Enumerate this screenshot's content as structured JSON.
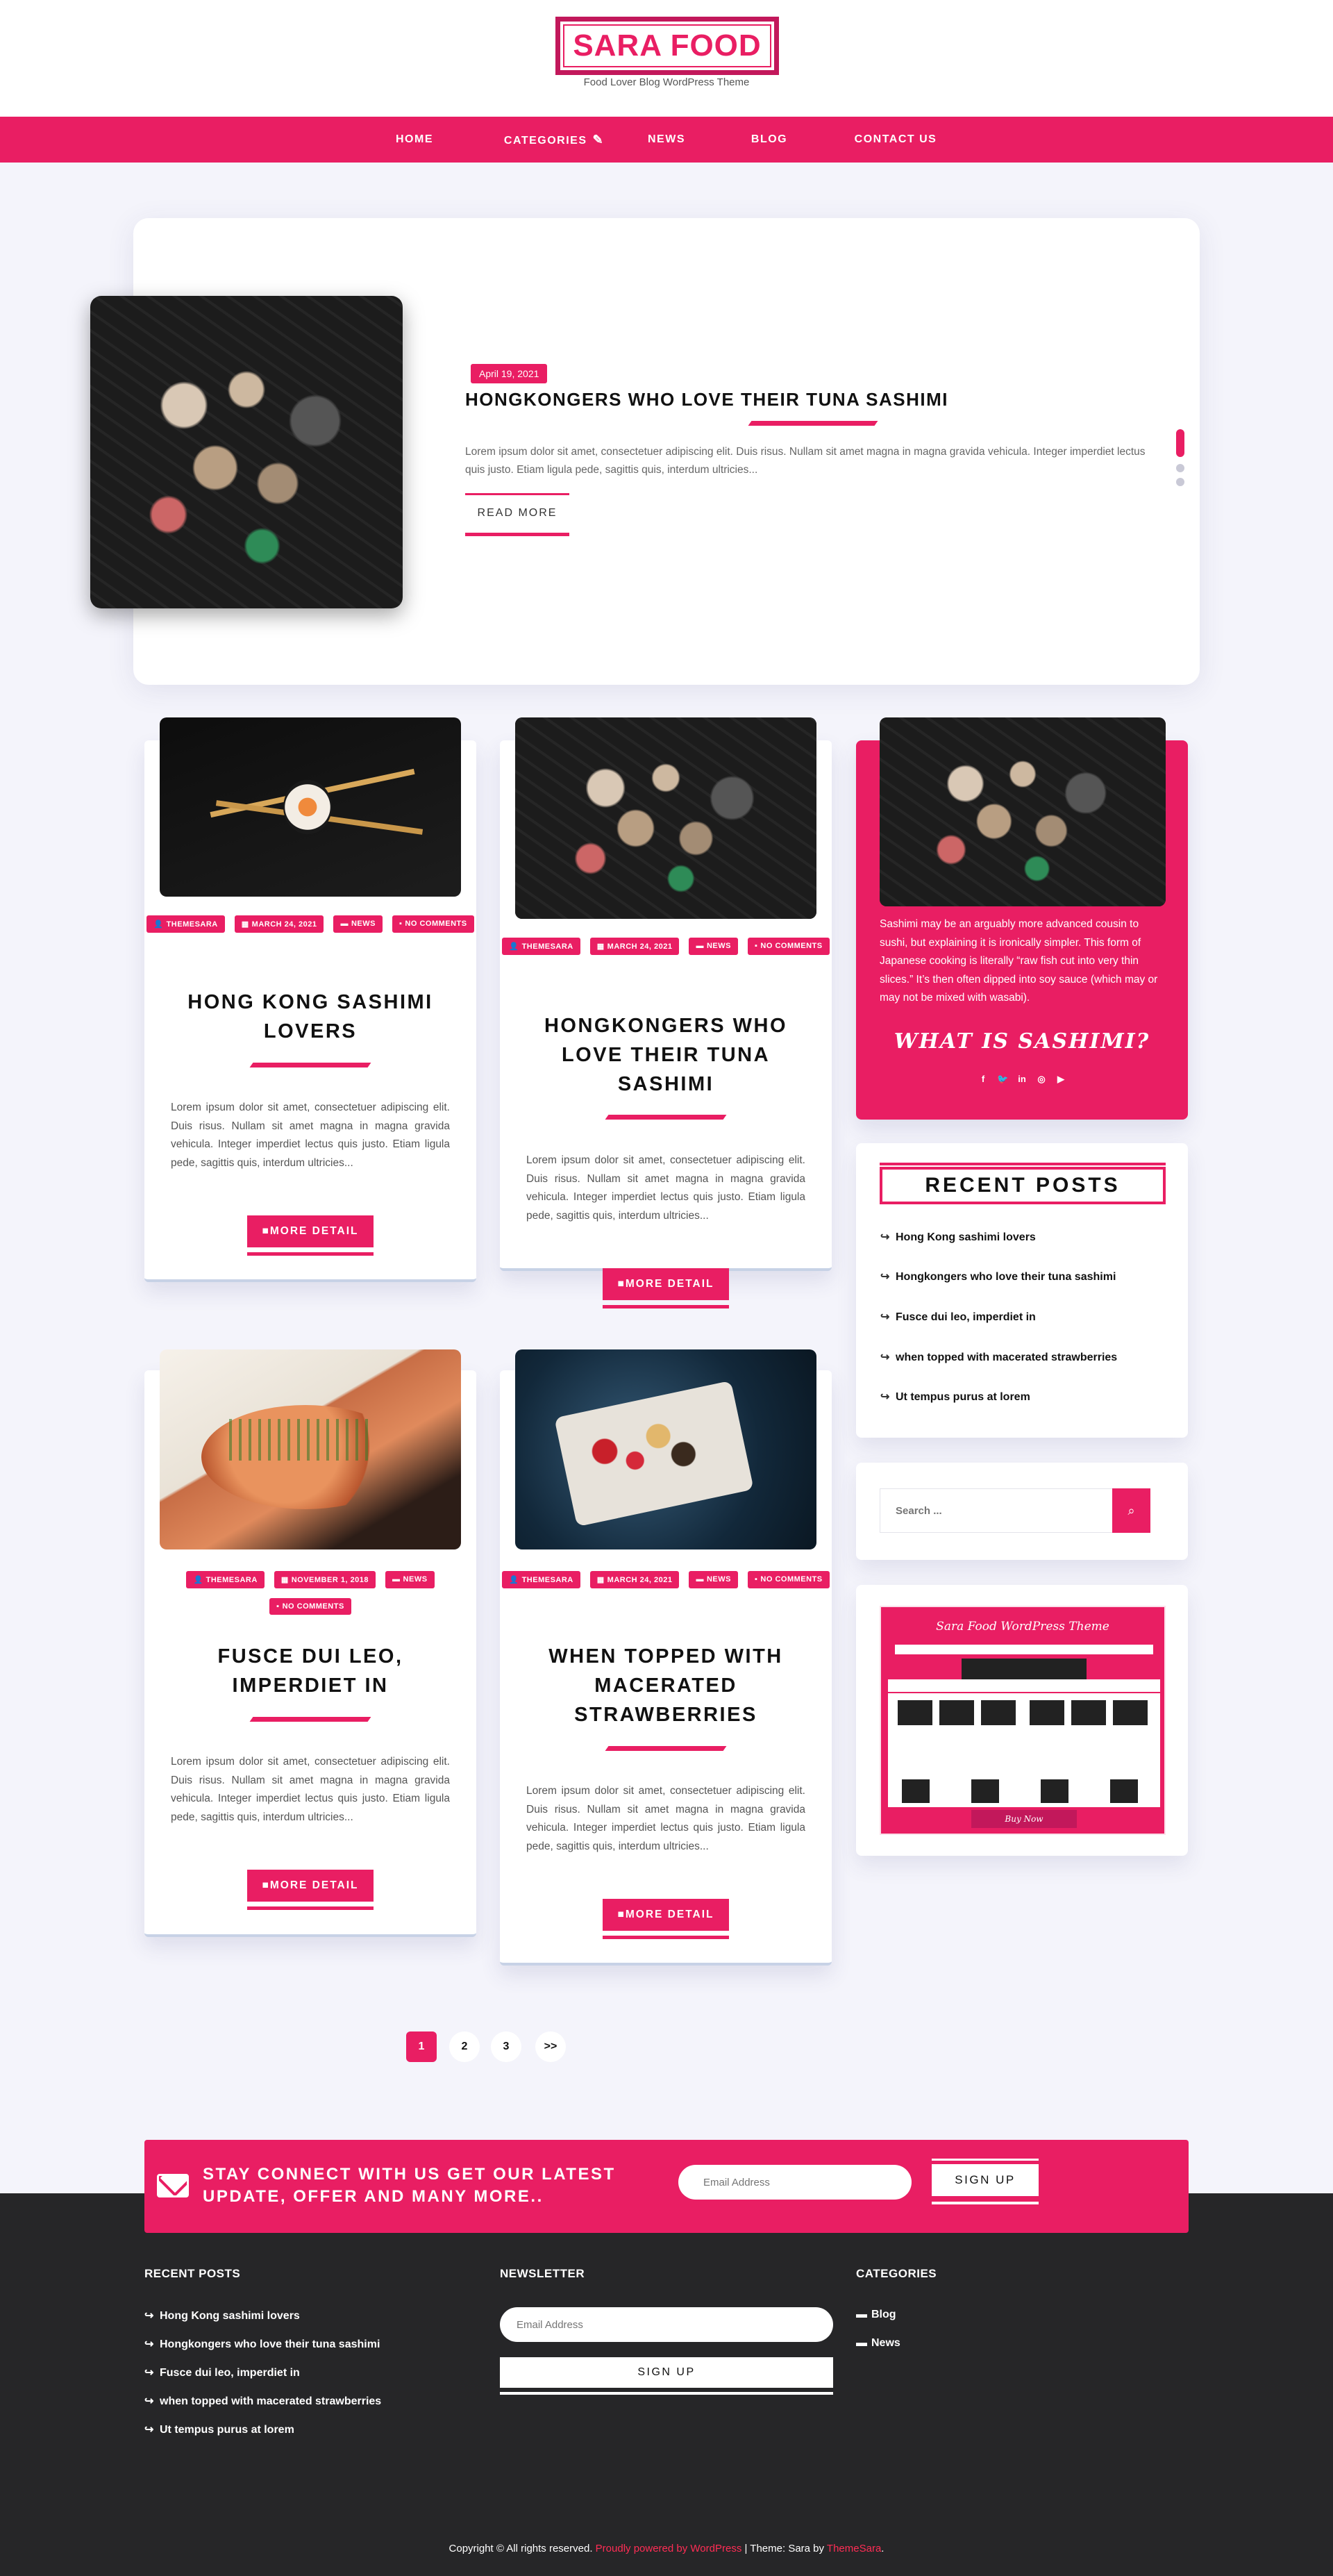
{
  "site": {
    "title": "SARA FOOD",
    "tagline": "Food Lover Blog WordPress Theme"
  },
  "nav": {
    "items": [
      {
        "label": "HOME"
      },
      {
        "label": "CATEGORIES"
      },
      {
        "label": "NEWS"
      },
      {
        "label": "BLOG"
      },
      {
        "label": "CONTACT US"
      }
    ]
  },
  "slider": {
    "date": "April 19, 2021",
    "title": "HONGKONGERS WHO LOVE THEIR TUNA SASHIMI",
    "excerpt": "Lorem ipsum dolor sit amet, consectetuer adipiscing elit. Duis risus. Nullam sit amet magna in magna gravida vehicula. Integer imperdiet lectus quis justo. Etiam ligula pede, sagittis quis, interdum ultricies...",
    "read_more": "READ MORE",
    "slide_count": 4,
    "active_slide": 1
  },
  "posts": [
    {
      "author": "THEMESARA",
      "date": "MARCH 24, 2021",
      "category": "NEWS",
      "comments": "NO COMMENTS",
      "title": "HONG KONG SASHIMI LOVERS",
      "excerpt": "Lorem ipsum dolor sit amet, consectetuer adipiscing elit. Duis risus. Nullam sit amet magna in magna gravida vehicula. Integer imperdiet lectus quis justo. Etiam ligula pede, sagittis quis, interdum ultricies...",
      "button": "MORE DETAIL"
    },
    {
      "author": "THEMESARA",
      "date": "MARCH 24, 2021",
      "category": "NEWS",
      "comments": "NO COMMENTS",
      "title": "HONGKONGERS WHO LOVE THEIR TUNA SASHIMI",
      "excerpt": "Lorem ipsum dolor sit amet, consectetuer adipiscing elit. Duis risus. Nullam sit amet magna in magna gravida vehicula. Integer imperdiet lectus quis justo. Etiam ligula pede, sagittis quis, interdum ultricies...",
      "button": "MORE DETAIL"
    },
    {
      "author": "THEMESARA",
      "date": "NOVEMBER 1, 2018",
      "category": "NEWS",
      "comments": "NO COMMENTS",
      "title": "FUSCE DUI LEO, IMPERDIET IN",
      "excerpt": "Lorem ipsum dolor sit amet, consectetuer adipiscing elit. Duis risus. Nullam sit amet magna in magna gravida vehicula. Integer imperdiet lectus quis justo. Etiam ligula pede, sagittis quis, interdum ultricies...",
      "button": "MORE DETAIL"
    },
    {
      "author": "THEMESARA",
      "date": "MARCH 24, 2021",
      "category": "NEWS",
      "comments": "NO COMMENTS",
      "title": "WHEN TOPPED WITH MACERATED STRAWBERRIES",
      "excerpt": "Lorem ipsum dolor sit amet, consectetuer adipiscing elit. Duis risus. Nullam sit amet magna in magna gravida vehicula. Integer imperdiet lectus quis justo. Etiam ligula pede, sagittis quis, interdum ultricies...",
      "button": "MORE DETAIL"
    }
  ],
  "sidebar": {
    "about_text": "Sashimi may be an arguably more advanced cousin to sushi, but explaining it is ironically simpler. This form of Japanese cooking is literally “raw fish cut into very thin slices.” It’s then often dipped into soy sauce (which may or may not be mixed with wasabi).",
    "about_heading": "WHAT IS SASHIMI?",
    "social": [
      "facebook-icon",
      "twitter-icon",
      "linkedin-icon",
      "instagram-icon",
      "youtube-icon"
    ],
    "recent_title": "RECENT POSTS",
    "recent_posts": [
      "Hong Kong sashimi lovers",
      "Hongkongers who love their tuna sashimi",
      "Fusce dui leo, imperdiet in",
      "when topped with macerated strawberries",
      "Ut tempus purus at lorem"
    ],
    "search_placeholder": "Search ...",
    "banner_title": "Sara Food WordPress Theme",
    "banner_button": "Buy Now"
  },
  "pagination": {
    "pages": [
      "1",
      "2",
      "3",
      ">>"
    ],
    "current": "1"
  },
  "subscribe": {
    "text": "STAY CONNECT WITH US GET OUR LATEST UPDATE, OFFER AND MANY MORE..",
    "email_placeholder": "Email Address",
    "button": "SIGN UP"
  },
  "footer": {
    "recent_heading": "RECENT POSTS",
    "recent_posts": [
      "Hong Kong sashimi lovers",
      "Hongkongers who love their tuna sashimi",
      "Fusce dui leo, imperdiet in",
      "when topped with macerated strawberries",
      "Ut tempus purus at lorem"
    ],
    "newsletter_heading": "NEWSLETTER",
    "newsletter_placeholder": "Email Address",
    "newsletter_button": "SIGN UP",
    "categories_heading": "CATEGORIES",
    "categories": [
      "Blog",
      "News"
    ],
    "copyright_prefix": "Copyright © All rights reserved.",
    "powered_by": "Proudly powered by WordPress",
    "theme_text": "| Theme: Sara by",
    "theme_author": "ThemeSara",
    "period": "."
  },
  "colors": {
    "accent": "#e91e63",
    "footer_bg": "#262628",
    "page_bg": "#f4f4fb"
  }
}
